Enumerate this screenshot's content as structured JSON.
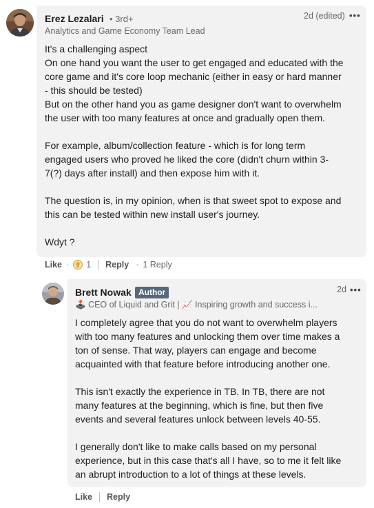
{
  "comment": {
    "author": "Erez Lezalari",
    "degree": "• 3rd+",
    "headline": "Analytics and Game Economy Team Lead",
    "time": "2d (edited)",
    "more": "•••",
    "paragraphs": [
      [
        "It's a challenging aspect",
        "On one hand you want the user to get engaged and educated with the",
        "core game and it's core loop mechanic (either in easy or hard manner",
        "- this should be tested)",
        "But on the other hand you as game designer don't want to overwhelm",
        "the user with too many features at once and gradually open them."
      ],
      [
        "For example, album/collection feature - which is for long term",
        "engaged users who proved he liked the core (didn't churn within 3-",
        "7(?) days after install) and then expose him with it."
      ],
      [
        "The question is, in my opinion, when is that sweet spot to expose and",
        "this can be tested within new install user's journey."
      ],
      [
        "Wdyt ?"
      ]
    ],
    "actions": {
      "like": "Like",
      "dot1": "·",
      "reaction_count": "1",
      "reply": "Reply",
      "dot2": "·",
      "replies": "1 Reply"
    }
  },
  "reply": {
    "author": "Brett Nowak",
    "badge": "Author",
    "headline": "🕹️ CEO of Liquid and Grit | 📈 Inspiring growth and success i...",
    "time": "2d",
    "more": "•••",
    "paragraphs": [
      [
        "I completely agree that you do not want to overwhelm players",
        "with too many features and unlocking them over time makes a",
        "ton of sense. That way, players can engage and become",
        "acquainted with that feature before introducing another one."
      ],
      [
        "This isn't exactly the experience in TB. In TB, there are not",
        "many features at the beginning, which is fine, but then five",
        "events and several features unlock between levels 40-55."
      ],
      [
        "I generally don't like to make calls based on my personal",
        "experience, but in this case that's all I have, so to me it felt like",
        "an abrupt introduction to a lot of things at these levels."
      ]
    ],
    "actions": {
      "like": "Like",
      "reply": "Reply"
    }
  },
  "icons": {
    "avatar_1": "avatar-photo-icon",
    "avatar_2": "avatar-photo-icon",
    "reaction": "insightful-lightbulb-icon"
  },
  "colors": {
    "bubble": "#f2f2f2",
    "badge": "#56687a",
    "muted": "#666666"
  }
}
